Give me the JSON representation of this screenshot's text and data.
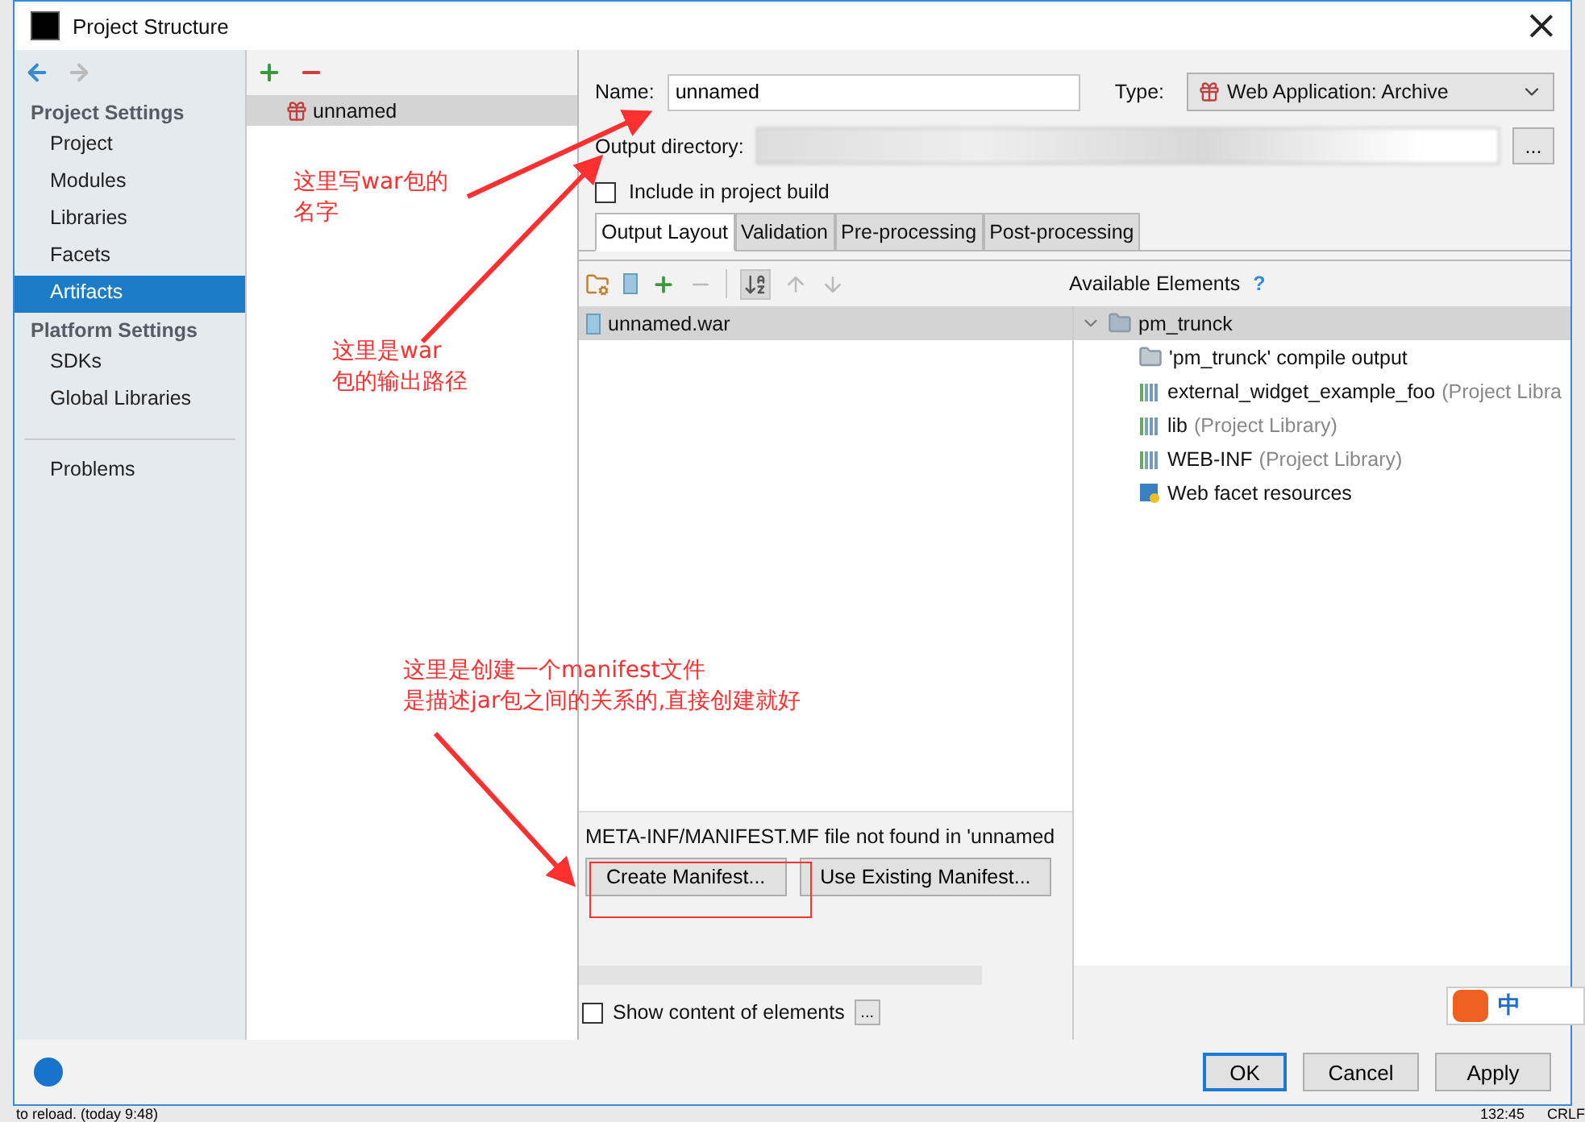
{
  "window": {
    "title": "Project Structure"
  },
  "sidebar": {
    "sections": [
      {
        "heading": "Project Settings",
        "items": [
          {
            "label": "Project",
            "selected": false
          },
          {
            "label": "Modules",
            "selected": false
          },
          {
            "label": "Libraries",
            "selected": false
          },
          {
            "label": "Facets",
            "selected": false
          },
          {
            "label": "Artifacts",
            "selected": true
          }
        ]
      },
      {
        "heading": "Platform Settings",
        "items": [
          {
            "label": "SDKs",
            "selected": false
          },
          {
            "label": "Global Libraries",
            "selected": false
          }
        ]
      }
    ],
    "footer_items": [
      {
        "label": "Problems",
        "selected": false
      }
    ]
  },
  "artifacts": [
    {
      "name": "unnamed",
      "selected": true
    }
  ],
  "name_field": {
    "label": "Name:",
    "value": "unnamed"
  },
  "type_select": {
    "label": "Type:",
    "value": "Web Application: Archive"
  },
  "output_directory": {
    "label": "Output directory:",
    "button": "..."
  },
  "include_in_build": {
    "label": "Include in project build",
    "checked": false
  },
  "tabs": [
    {
      "label": "Output Layout",
      "selected": true
    },
    {
      "label": "Validation",
      "selected": false
    },
    {
      "label": "Pre-processing",
      "selected": false
    },
    {
      "label": "Post-processing",
      "selected": false
    }
  ],
  "output_layout": {
    "items": [
      {
        "label": "unnamed.war",
        "selected": true
      }
    ]
  },
  "available_elements": {
    "title": "Available Elements",
    "help": "?",
    "tree": [
      {
        "label": "pm_trunck",
        "kind": "module",
        "expanded": true,
        "selected": true,
        "children": [
          {
            "label": "'pm_trunck' compile output",
            "kind": "output",
            "selected": false
          },
          {
            "label": "external_widget_example_foo",
            "note": "(Project Libra",
            "kind": "library",
            "selected": false
          },
          {
            "label": "lib",
            "note": "(Project Library)",
            "kind": "library",
            "selected": false
          },
          {
            "label": "WEB-INF",
            "note": "(Project Library)",
            "kind": "library",
            "selected": false
          },
          {
            "label": "Web facet resources",
            "kind": "facet",
            "selected": false
          }
        ]
      }
    ]
  },
  "manifest": {
    "message": "META-INF/MANIFEST.MF file not found in 'unnamed",
    "buttons": [
      "Create Manifest...",
      "Use Existing Manifest..."
    ]
  },
  "show_content": {
    "label": "Show content of elements",
    "checked": false,
    "button": "..."
  },
  "buttons": [
    {
      "label": "OK",
      "default": true
    },
    {
      "label": "Cancel",
      "default": false
    },
    {
      "label": "Apply",
      "default": false
    }
  ],
  "annotations": [
    {
      "lines": [
        "这里写war包的",
        "名字"
      ]
    },
    {
      "lines": [
        "这里是war",
        "包的输出路径"
      ]
    },
    {
      "lines": [
        "这里是创建一个manifest文件",
        "是描述jar包之间的关系的,直接创建就好"
      ]
    }
  ],
  "status_bar": {
    "message": "to reload. (today 9:48)",
    "position": "132:45",
    "line_ending": "CRLF"
  },
  "ime": {
    "mode": "中"
  }
}
